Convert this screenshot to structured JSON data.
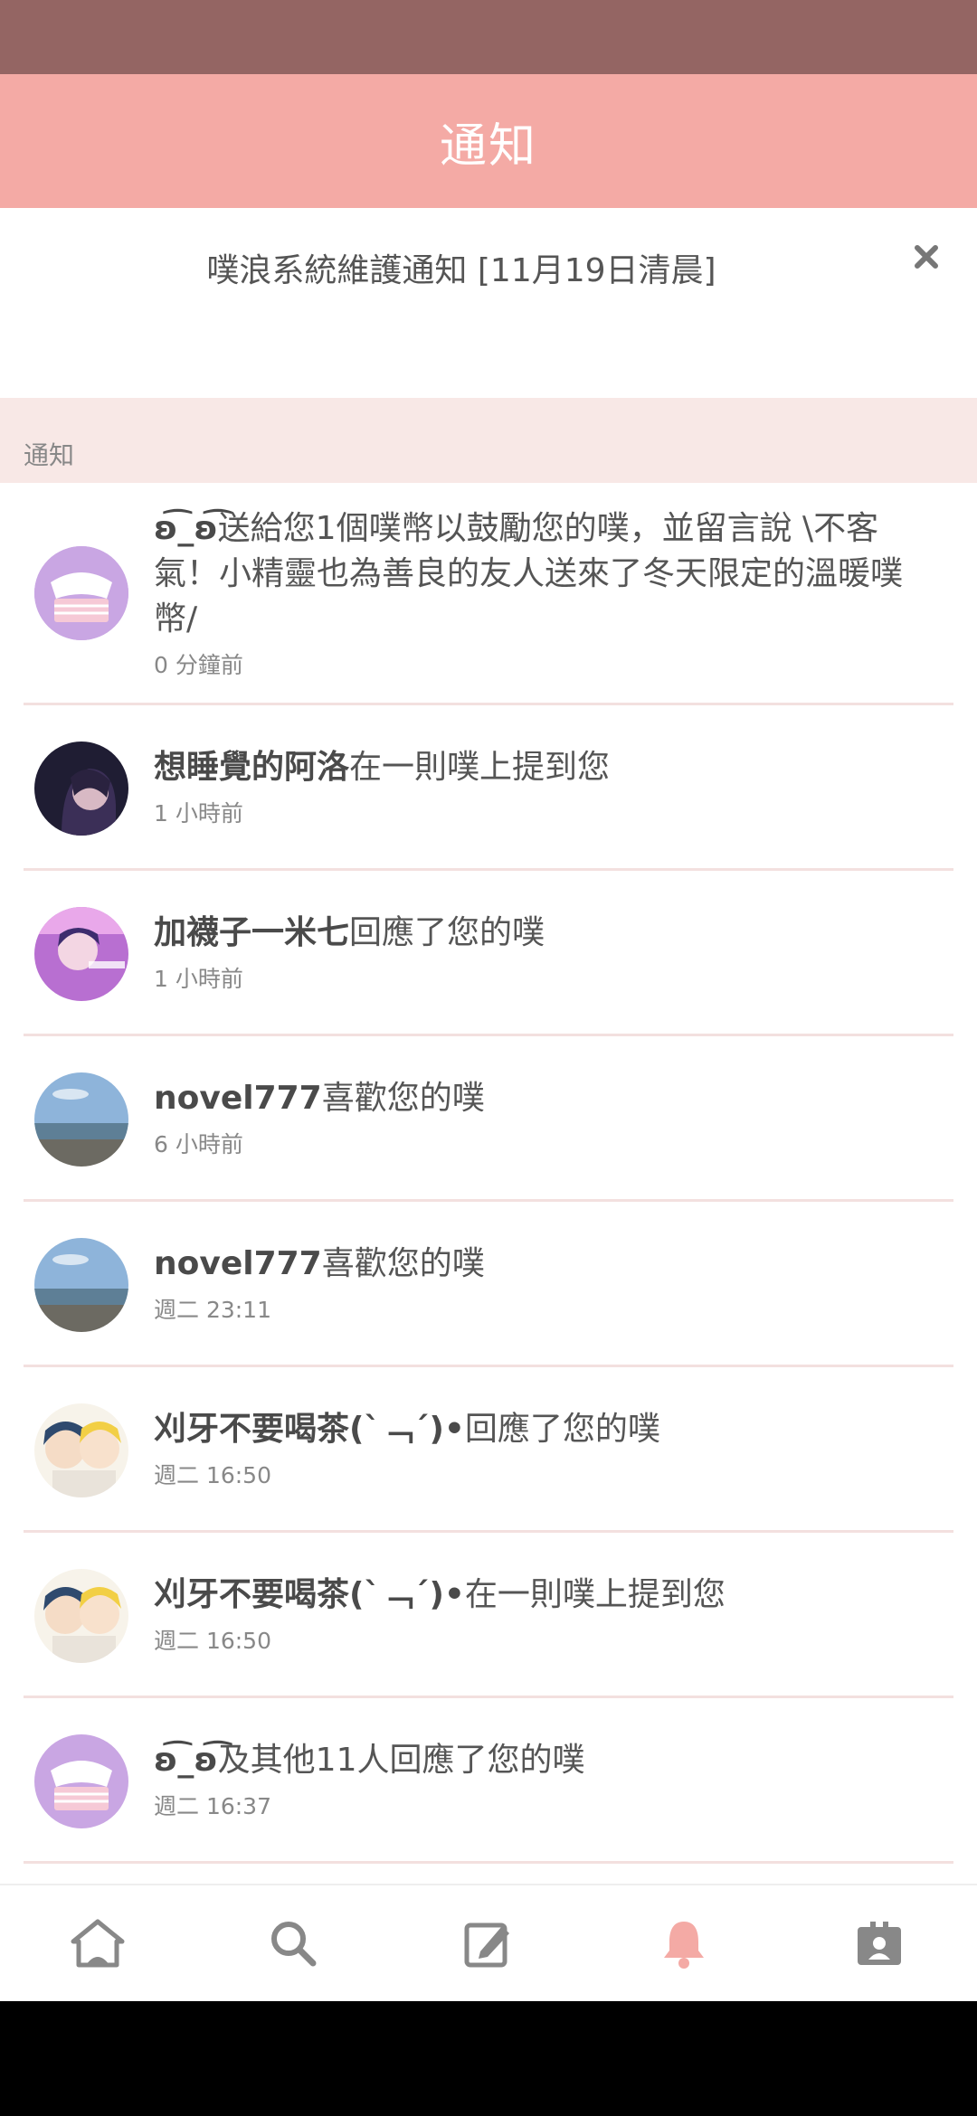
{
  "header": {
    "title": "通知"
  },
  "announcement": {
    "text": "噗浪系統維護通知 [11月19日清晨]"
  },
  "section": {
    "label": "通知"
  },
  "notifications": [
    {
      "actor": "ʚ͡_ʚ͡",
      "action": "送給您1個噗幣以鼓勵您的噗，並留言說 \\不客氣！小精靈也為善良的友人送來了冬天限定的溫暖噗幣/",
      "time": "0 分鐘前"
    },
    {
      "actor": "想睡覺的阿洛",
      "action": "在一則噗上提到您",
      "time": "1 小時前"
    },
    {
      "actor": "加襪子一米七",
      "action": "回應了您的噗",
      "time": "1 小時前"
    },
    {
      "actor": "novel777",
      "action": "喜歡您的噗",
      "time": "6 小時前"
    },
    {
      "actor": "novel777",
      "action": "喜歡您的噗",
      "time": "週二 23:11"
    },
    {
      "actor": "刈牙不要喝茶(ˋ﹁ˊ)•",
      "action": "回應了您的噗",
      "time": "週二 16:50"
    },
    {
      "actor": "刈牙不要喝茶(ˋ﹁ˊ)•",
      "action": "在一則噗上提到您",
      "time": "週二 16:50"
    },
    {
      "actor": "ʚ͡_ʚ͡",
      "action": "及其他11人回應了您的噗",
      "time": "週二 16:37"
    }
  ],
  "tabs": [
    {
      "icon": "home-icon",
      "active": false
    },
    {
      "icon": "search-icon",
      "active": false
    },
    {
      "icon": "compose-icon",
      "active": false
    },
    {
      "icon": "bell-icon",
      "active": true
    },
    {
      "icon": "profile-card-icon",
      "active": false
    }
  ],
  "colors": {
    "status_bar": "#946563",
    "accent": "#f4aaa5",
    "section_bg": "#f8e8e6",
    "active_tab": "#f4aaa5",
    "inactive_tab": "#888888"
  }
}
